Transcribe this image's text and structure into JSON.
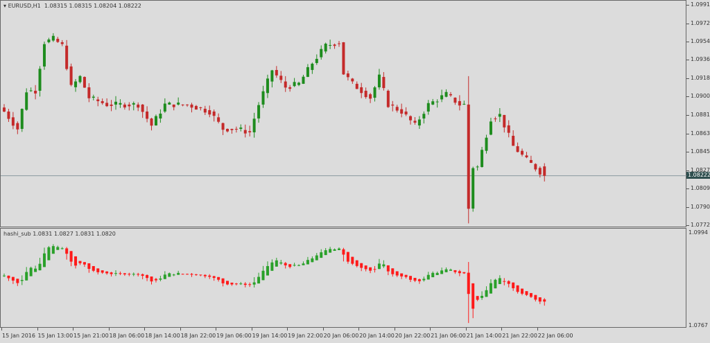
{
  "main": {
    "symbol_label": "EURUSD,H1",
    "ohlc_readout": "1.08315 1.08315 1.08204 1.08222",
    "price_axis": [
      "1.09910",
      "1.09725",
      "1.09545",
      "1.09365",
      "1.09180",
      "1.09000",
      "1.08815",
      "1.08635",
      "1.08450",
      "1.08270",
      "1.08090",
      "1.07905",
      "1.07725"
    ],
    "current_price": "1.08222"
  },
  "sub": {
    "indicator_label": "hashi_sub",
    "readout": "1.0831 1.0827 1.0831 1.0820",
    "axis_max": "1.0994",
    "axis_min": "1.0767"
  },
  "time_axis": [
    "15 Jan 2016",
    "15 Jan 13:00",
    "15 Jan 21:00",
    "18 Jan 06:00",
    "18 Jan 14:00",
    "18 Jan 22:00",
    "19 Jan 06:00",
    "19 Jan 14:00",
    "19 Jan 22:00",
    "20 Jan 06:00",
    "20 Jan 14:00",
    "20 Jan 22:00",
    "21 Jan 06:00",
    "21 Jan 14:00",
    "21 Jan 22:00",
    "22 Jan 06:00"
  ],
  "colors": {
    "bull": "#1e8c1e",
    "bear": "#c42a2a",
    "ha_bull": "#2aa02a",
    "ha_bear": "#ff1a1a",
    "current_line": "#8a9aa0"
  },
  "chart_data": {
    "type": "candlestick",
    "title": "EURUSD,H1",
    "ylim": [
      1.07725,
      1.0991
    ],
    "sub_ylim": [
      1.0767,
      1.0994
    ],
    "close_anchors": [
      [
        0,
        1.08859
      ],
      [
        3,
        1.08687
      ],
      [
        5,
        1.09065
      ],
      [
        7,
        1.09065
      ],
      [
        9,
        1.09546
      ],
      [
        11,
        1.0958
      ],
      [
        13,
        1.09512
      ],
      [
        15,
        1.091
      ],
      [
        17,
        1.09202
      ],
      [
        19,
        1.08996
      ],
      [
        23,
        1.08928
      ],
      [
        27,
        1.08928
      ],
      [
        30,
        1.08928
      ],
      [
        33,
        1.08721
      ],
      [
        36,
        1.08928
      ],
      [
        41,
        1.08928
      ],
      [
        46,
        1.08859
      ],
      [
        49,
        1.08687
      ],
      [
        52,
        1.08687
      ],
      [
        55,
        1.08653
      ],
      [
        57,
        1.08928
      ],
      [
        60,
        1.09271
      ],
      [
        63,
        1.091
      ],
      [
        66,
        1.09134
      ],
      [
        69,
        1.0934
      ],
      [
        72,
        1.09512
      ],
      [
        75,
        1.09546
      ],
      [
        76,
        1.09237
      ],
      [
        78,
        1.09134
      ],
      [
        82,
        1.08996
      ],
      [
        84,
        1.09202
      ],
      [
        86,
        1.08928
      ],
      [
        89,
        1.08859
      ],
      [
        92,
        1.08721
      ],
      [
        95,
        1.08928
      ],
      [
        99,
        1.09031
      ],
      [
        102,
        1.08928
      ],
      [
        103,
        1.08928
      ],
      [
        104,
        1.07897
      ],
      [
        105,
        1.08309
      ],
      [
        106,
        1.08309
      ],
      [
        109,
        1.0879
      ],
      [
        111,
        1.08825
      ],
      [
        114,
        1.08515
      ],
      [
        117,
        1.08378
      ],
      [
        121,
        1.08222
      ]
    ]
  }
}
